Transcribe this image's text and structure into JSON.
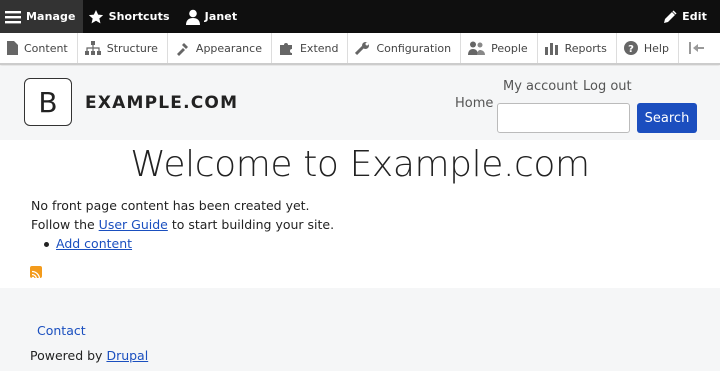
{
  "admin_bar": {
    "manage": "Manage",
    "shortcuts": "Shortcuts",
    "user": "Janet",
    "edit": "Edit"
  },
  "tray": {
    "items": [
      "Content",
      "Structure",
      "Appearance",
      "Extend",
      "Configuration",
      "People",
      "Reports",
      "Help"
    ]
  },
  "header": {
    "logo_letter": "B",
    "site_name": "EXAMPLE.COM",
    "my_account": "My account",
    "log_out": "Log out",
    "home": "Home",
    "search_button": "Search",
    "search_value": ""
  },
  "main": {
    "title": "Welcome to Example.com",
    "no_content": "No front page content has been created yet.",
    "follow_prefix": "Follow the ",
    "user_guide": "User Guide",
    "follow_suffix": " to start building your site.",
    "add_content": "Add content"
  },
  "footer": {
    "contact": "Contact",
    "powered_prefix": "Powered by ",
    "drupal": "Drupal"
  },
  "colors": {
    "admin_bg": "#0f0f0f",
    "accent": "#1b4ebf",
    "link": "#1a4fbf",
    "rss": "#f39b1c"
  }
}
